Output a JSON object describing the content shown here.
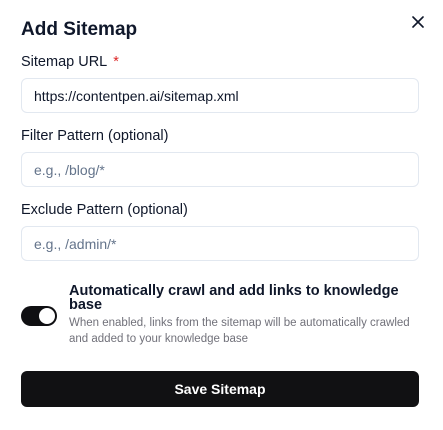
{
  "dialog": {
    "title": "Add Sitemap",
    "close_icon": "close-icon"
  },
  "fields": {
    "sitemap_url": {
      "label": "Sitemap URL",
      "required_marker": "*",
      "value": "https://contentpen.ai/sitemap.xml",
      "placeholder": ""
    },
    "filter_pattern": {
      "label": "Filter Pattern (optional)",
      "value": "",
      "placeholder": "e.g., /blog/*"
    },
    "exclude_pattern": {
      "label": "Exclude Pattern (optional)",
      "value": "",
      "placeholder": "e.g., /admin/*"
    }
  },
  "auto_crawl": {
    "enabled": true,
    "title": "Automatically crawl and add links to knowledge base",
    "description": "When enabled, links from the sitemap will be automatically crawled and added to your knowledge base"
  },
  "actions": {
    "save_label": "Save Sitemap"
  },
  "colors": {
    "primary": "#111113",
    "required": "#dc2626",
    "muted": "#71717a",
    "border": "#e2e8f0"
  }
}
